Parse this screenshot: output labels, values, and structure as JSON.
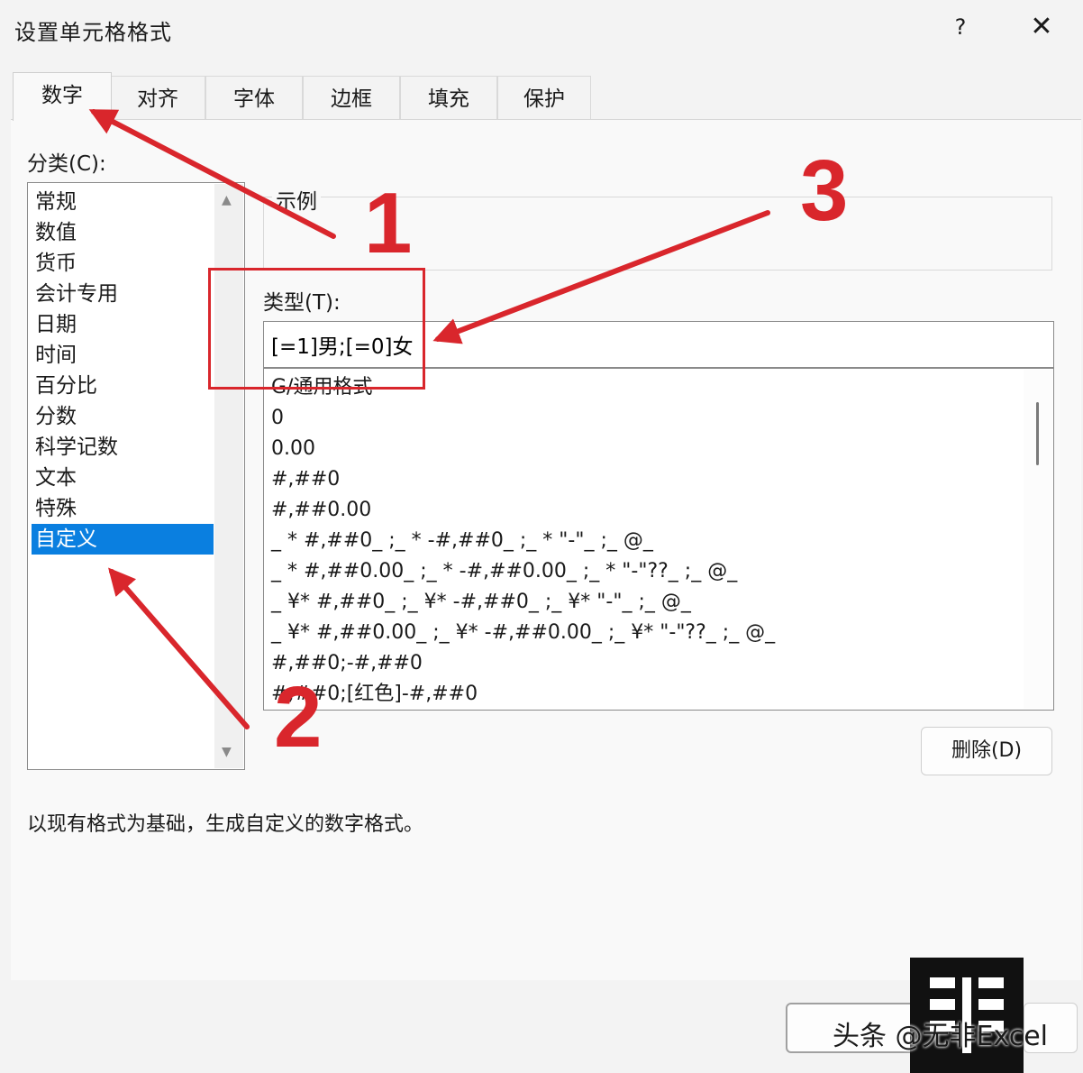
{
  "window": {
    "title": "设置单元格格式",
    "help": "?",
    "close": "✕"
  },
  "tabs": [
    {
      "label": "数字",
      "active": true
    },
    {
      "label": "对齐"
    },
    {
      "label": "字体"
    },
    {
      "label": "边框"
    },
    {
      "label": "填充"
    },
    {
      "label": "保护"
    }
  ],
  "category": {
    "label": "分类(C):",
    "items": [
      "常规",
      "数值",
      "货币",
      "会计专用",
      "日期",
      "时间",
      "百分比",
      "分数",
      "科学记数",
      "文本",
      "特殊",
      "自定义"
    ],
    "selected": "自定义"
  },
  "sample": {
    "label": "示例"
  },
  "type": {
    "label": "类型(T):",
    "value": "[=1]男;[=0]女",
    "formats": [
      "G/通用格式",
      "0",
      "0.00",
      "#,##0",
      "#,##0.00",
      "_ * #,##0_ ;_ * -#,##0_ ;_ * \"-\"_ ;_ @_",
      "_ * #,##0.00_ ;_ * -#,##0.00_ ;_ * \"-\"??_ ;_ @_",
      "_ ¥* #,##0_ ;_ ¥* -#,##0_ ;_ ¥* \"-\"_ ;_ @_",
      "_ ¥* #,##0.00_ ;_ ¥* -#,##0.00_ ;_ ¥* \"-\"??_ ;_ @_",
      "#,##0;-#,##0",
      "#,##0;[红色]-#,##0"
    ]
  },
  "buttons": {
    "delete": "删除(D)"
  },
  "description": "以现有格式为基础，生成自定义的数字格式。",
  "annotations": {
    "n1": "1",
    "n2": "2",
    "n3": "3",
    "color": "#d9262c"
  },
  "watermark": {
    "text": "头条 @无非Excel"
  },
  "colors": {
    "selection": "#0a7fe0",
    "annotation": "#d9262c"
  }
}
